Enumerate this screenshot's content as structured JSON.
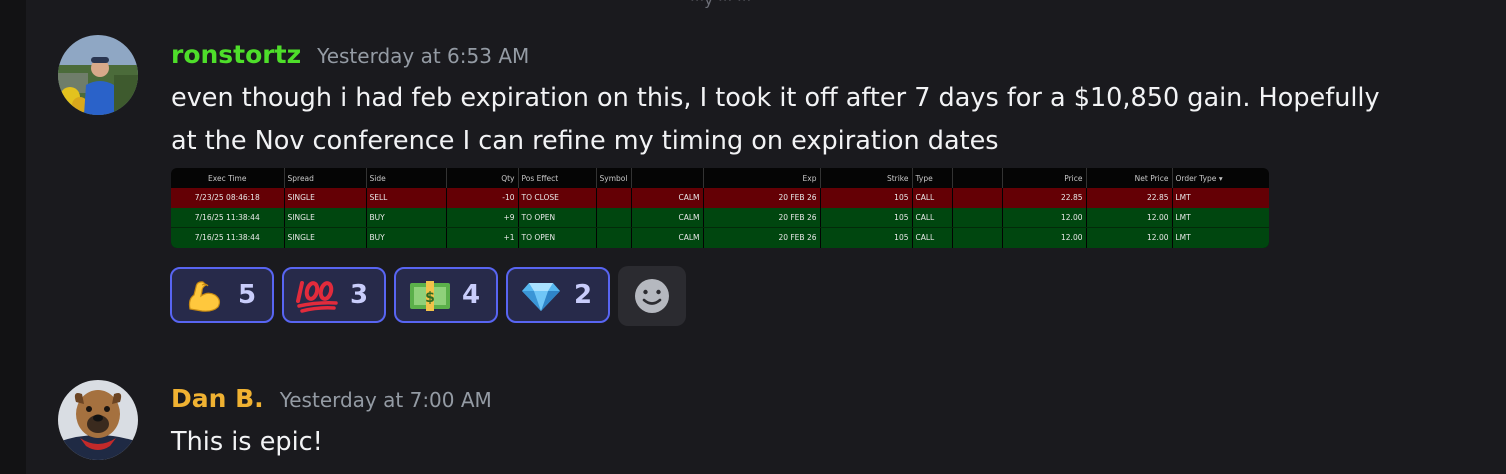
{
  "top_fragment": "···y ··· ···",
  "messages": [
    {
      "author": "ronstortz",
      "author_color": "#4ede2a",
      "timestamp": "Yesterday at 6:53 AM",
      "lines": [
        "even though i had feb expiration on this, I took it off after 7 days for a $10,850 gain. Hopefully",
        "at the Nov conference I can refine my timing on expiration dates"
      ],
      "attachment": {
        "columns": [
          "Exec Time",
          "Spread",
          "Side",
          "Qty",
          "Pos Effect",
          "Symbol",
          "",
          "Exp",
          "Strike",
          "Type",
          "",
          "Price",
          "Net Price",
          "Order Type"
        ],
        "rows": [
          [
            "7/23/25 08:46:18",
            "SINGLE",
            "SELL",
            "-10",
            "TO CLOSE",
            "",
            "CALM",
            "20 FEB 26",
            "105",
            "CALL",
            "",
            "22.85",
            "22.85",
            "LMT"
          ],
          [
            "7/16/25 11:38:44",
            "SINGLE",
            "BUY",
            "+9",
            "TO OPEN",
            "",
            "CALM",
            "20 FEB 26",
            "105",
            "CALL",
            "",
            "12.00",
            "12.00",
            "LMT"
          ],
          [
            "7/16/25 11:38:44",
            "SINGLE",
            "BUY",
            "+1",
            "TO OPEN",
            "",
            "CALM",
            "20 FEB 26",
            "105",
            "CALL",
            "",
            "12.00",
            "12.00",
            "LMT"
          ]
        ],
        "row_colors": [
          "#640005",
          "#00460f",
          "#00460f"
        ]
      },
      "reactions": [
        {
          "emoji": "flexed-biceps",
          "count": "5"
        },
        {
          "emoji": "hundred-points",
          "count": "3"
        },
        {
          "emoji": "dollar-banknote",
          "count": "4"
        },
        {
          "emoji": "gem-stone",
          "count": "2"
        }
      ]
    },
    {
      "author": "Dan B.",
      "author_color": "#f0b232",
      "timestamp": "Yesterday at 7:00 AM",
      "lines": [
        "This is epic!"
      ]
    }
  ]
}
